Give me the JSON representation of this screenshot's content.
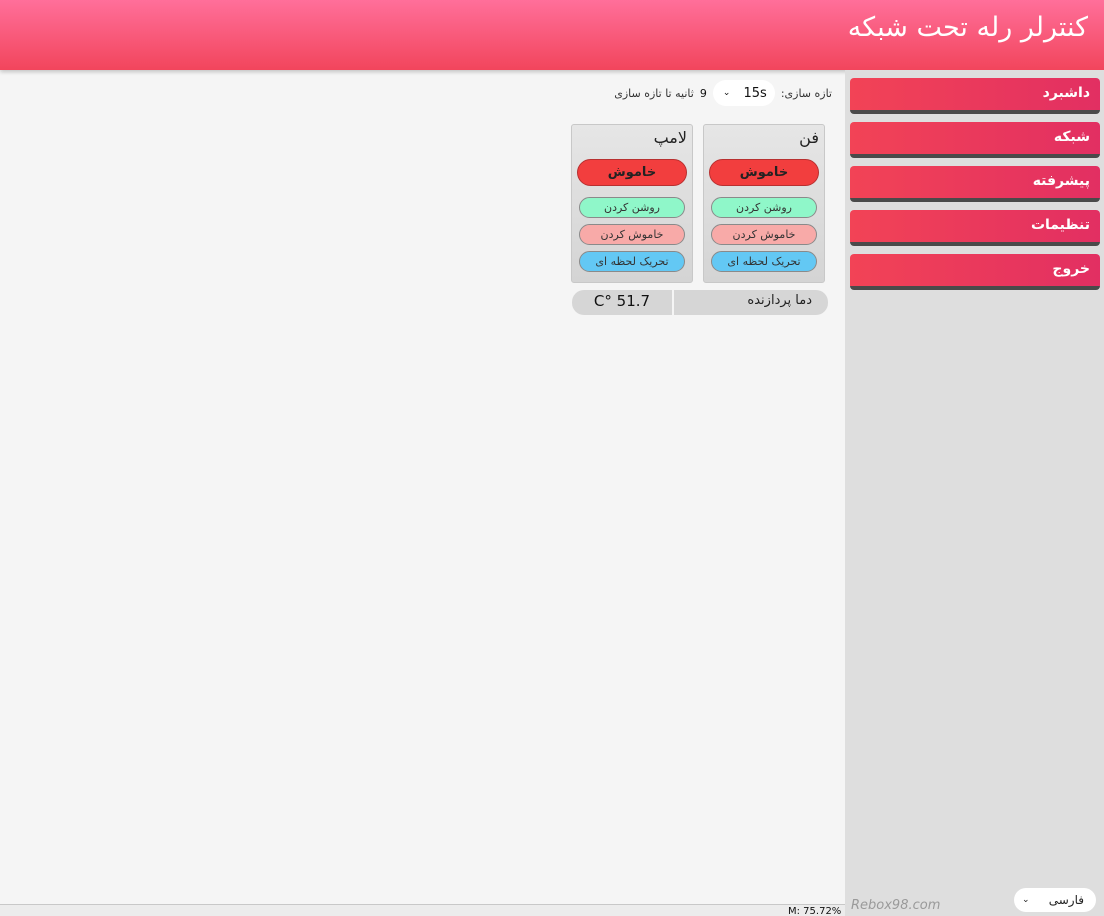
{
  "header": {
    "title": "کنترلر رله تحت شبکه"
  },
  "sidebar": {
    "items": [
      {
        "label": "داشبرد"
      },
      {
        "label": "شبکه"
      },
      {
        "label": "پیشرفته"
      },
      {
        "label": "تنظیمات"
      },
      {
        "label": "خروج"
      }
    ],
    "brand": "Rebox98.com",
    "language": {
      "selected": "فارسی"
    }
  },
  "refresh": {
    "label": "تازه سازی:",
    "interval": "15s",
    "countdown_value": "9",
    "countdown_suffix": "ثانیه تا تازه سازی"
  },
  "relays": [
    {
      "name": "فن",
      "status": "خاموش",
      "on_label": "روشن کردن",
      "off_label": "خاموش کردن",
      "pulse_label": "تحریک لحظه ای"
    },
    {
      "name": "لامپ",
      "status": "خاموش",
      "on_label": "روشن کردن",
      "off_label": "خاموش کردن",
      "pulse_label": "تحریک لحظه ای"
    }
  ],
  "temperature": {
    "label": "دما پردازنده",
    "value": "C° 51.7"
  },
  "memory": {
    "text": "M: 75.72%"
  },
  "colors": {
    "header_top": "#ff6f9a",
    "header_bottom": "#f2455c",
    "menu_button": "#f24356",
    "status_off": "#f23e3e",
    "btn_on": "#8ff7c9",
    "btn_off": "#f8aaa8",
    "btn_pulse": "#63c8f4"
  },
  "icons": {
    "dropdown": "chevron-down-icon"
  }
}
